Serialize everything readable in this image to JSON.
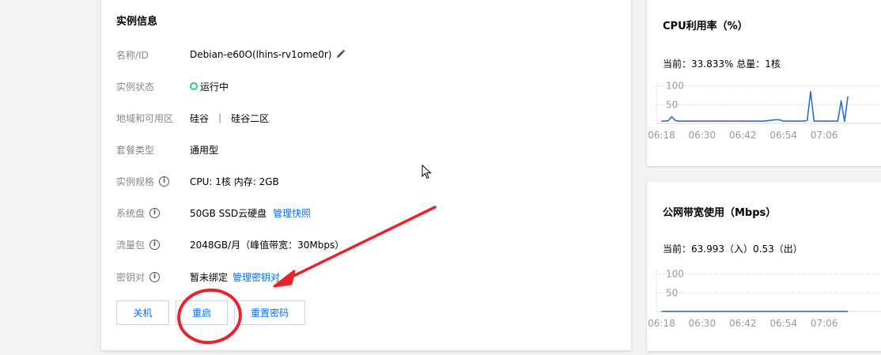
{
  "instance": {
    "title": "实例信息",
    "fields": [
      {
        "label": "名称/ID",
        "value": "Debian-e60O(lhins-rv1ome0r)"
      },
      {
        "label": "实例状态",
        "value": "运行中"
      },
      {
        "label": "地域和可用区",
        "value_region": "硅谷",
        "value_sep": "|",
        "value_zone": "硅谷二区"
      },
      {
        "label": "套餐类型",
        "value": "通用型"
      },
      {
        "label": "实例规格",
        "value": "CPU: 1核 内存: 2GB"
      },
      {
        "label": "系统盘",
        "value": "50GB SSD云硬盘",
        "link": "管理快照"
      },
      {
        "label": "流量包",
        "value": "2048GB/月（峰值带宽：30Mbps）"
      },
      {
        "label": "密钥对",
        "value": "暂未绑定",
        "link": "管理密钥对"
      }
    ],
    "buttons": {
      "shutdown": "关机",
      "restart": "重启",
      "reset_password": "重置密码"
    },
    "status_color": "#29cc85",
    "link_color": "#006eff"
  },
  "cpu_chart": {
    "title": "CPU利用率（%）",
    "current_text": "当前：33.833% 总量：1核"
  },
  "net_chart": {
    "title": "公网带宽使用（Mbps）",
    "current_text": "当前：63.993（入）0.53（出）"
  },
  "chart_data": [
    {
      "type": "line",
      "title": "CPU利用率（%）",
      "x_ticks": [
        "06:18",
        "06:30",
        "06:42",
        "06:54",
        "07:06"
      ],
      "y_ticks": [
        50,
        100
      ],
      "ylim": [
        0,
        110
      ],
      "x": [
        "06:18",
        "06:19",
        "06:20",
        "06:21",
        "06:22",
        "06:23",
        "06:24",
        "06:26",
        "06:30",
        "06:36",
        "06:42",
        "06:48",
        "06:52",
        "06:53",
        "06:54",
        "06:56",
        "07:00",
        "07:01",
        "07:02",
        "07:03",
        "07:04",
        "07:05",
        "07:06",
        "07:08",
        "07:10",
        "07:11",
        "07:12",
        "07:13"
      ],
      "series": [
        {
          "values": [
            6,
            6,
            7,
            18,
            8,
            6,
            6,
            6,
            6,
            6,
            6,
            6,
            10,
            9,
            6,
            6,
            6,
            8,
            85,
            6,
            6,
            6,
            6,
            6,
            6,
            60,
            5,
            72
          ]
        }
      ],
      "color": "#2b6fcf",
      "grid": true
    },
    {
      "type": "line",
      "title": "公网带宽使用（Mbps）",
      "x_ticks": [
        "06:18",
        "06:30",
        "06:42",
        "06:54",
        "07:06"
      ],
      "y_ticks": [
        50,
        100
      ],
      "ylim": [
        0,
        110
      ],
      "x": [
        "06:18",
        "07:13"
      ],
      "series": [
        {
          "values": [
            0.5,
            0.5
          ]
        }
      ],
      "color": "#2b6fcf",
      "grid": true
    }
  ],
  "annotation": {
    "color": "#e8232a"
  }
}
